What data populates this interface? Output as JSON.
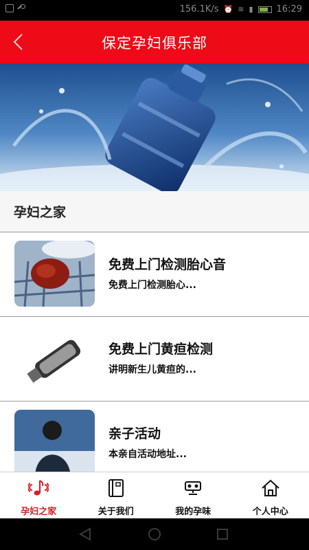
{
  "status_bar": {
    "net_speed": "156.1K/s",
    "time": "16:29"
  },
  "header": {
    "title": "保定孕妇俱乐部"
  },
  "section": {
    "title": "孕妇之家"
  },
  "items": [
    {
      "title": "免费上门检测胎心音",
      "desc": "免费上门检测胎心..."
    },
    {
      "title": "免费上门黄疸检测",
      "desc": "讲明新生儿黄疸的..."
    },
    {
      "title": "亲子活动",
      "desc": "本亲自活动地址..."
    }
  ],
  "tabs": [
    {
      "label": "孕妇之家",
      "icon": "music-note-icon",
      "active": true
    },
    {
      "label": "关于我们",
      "icon": "book-icon",
      "active": false
    },
    {
      "label": "我的孕味",
      "icon": "camera-icon",
      "active": false
    },
    {
      "label": "个人中心",
      "icon": "home-icon",
      "active": false
    }
  ],
  "colors": {
    "brand_red": "#ef0a17",
    "active_tab": "#d81e24"
  }
}
